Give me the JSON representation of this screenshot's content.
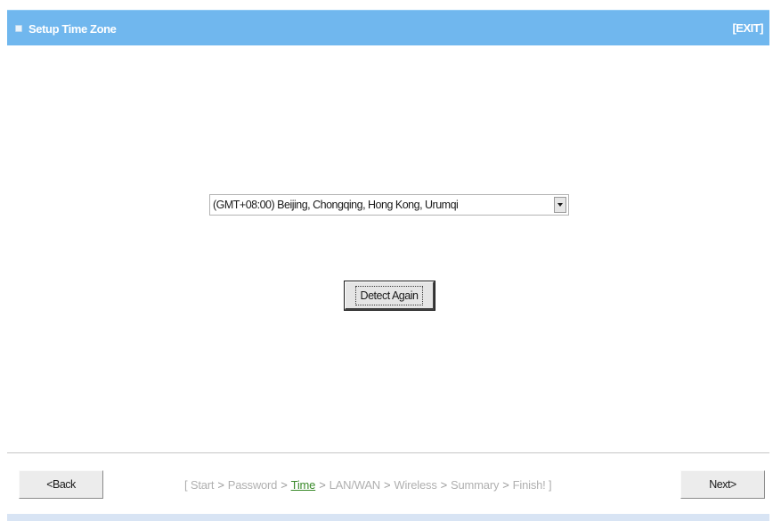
{
  "header": {
    "title": "Setup Time Zone",
    "exit_label": "[EXIT]",
    "icon": "bullet-icon"
  },
  "timezone": {
    "selected": "(GMT+08:00) Beijing, Chongqing, Hong Kong, Urumqi",
    "dropdown_icon": "chevron-down-icon"
  },
  "detect_button": {
    "label": "Detect Again"
  },
  "footer": {
    "back_label": "<Back",
    "next_label": "Next>",
    "steps": {
      "open_bracket": "[",
      "start": "Start",
      "password": "Password",
      "time": "Time",
      "lan_wan": "LAN/WAN",
      "wireless": "Wireless",
      "summary": "Summary",
      "finish": "Finish!",
      "close_bracket": "]",
      "separator": ">"
    },
    "current_step": "Time"
  },
  "colors": {
    "header_bg": "#70b7ee",
    "current_step": "#3a8a2a",
    "inactive_step": "#b0b0b0"
  }
}
